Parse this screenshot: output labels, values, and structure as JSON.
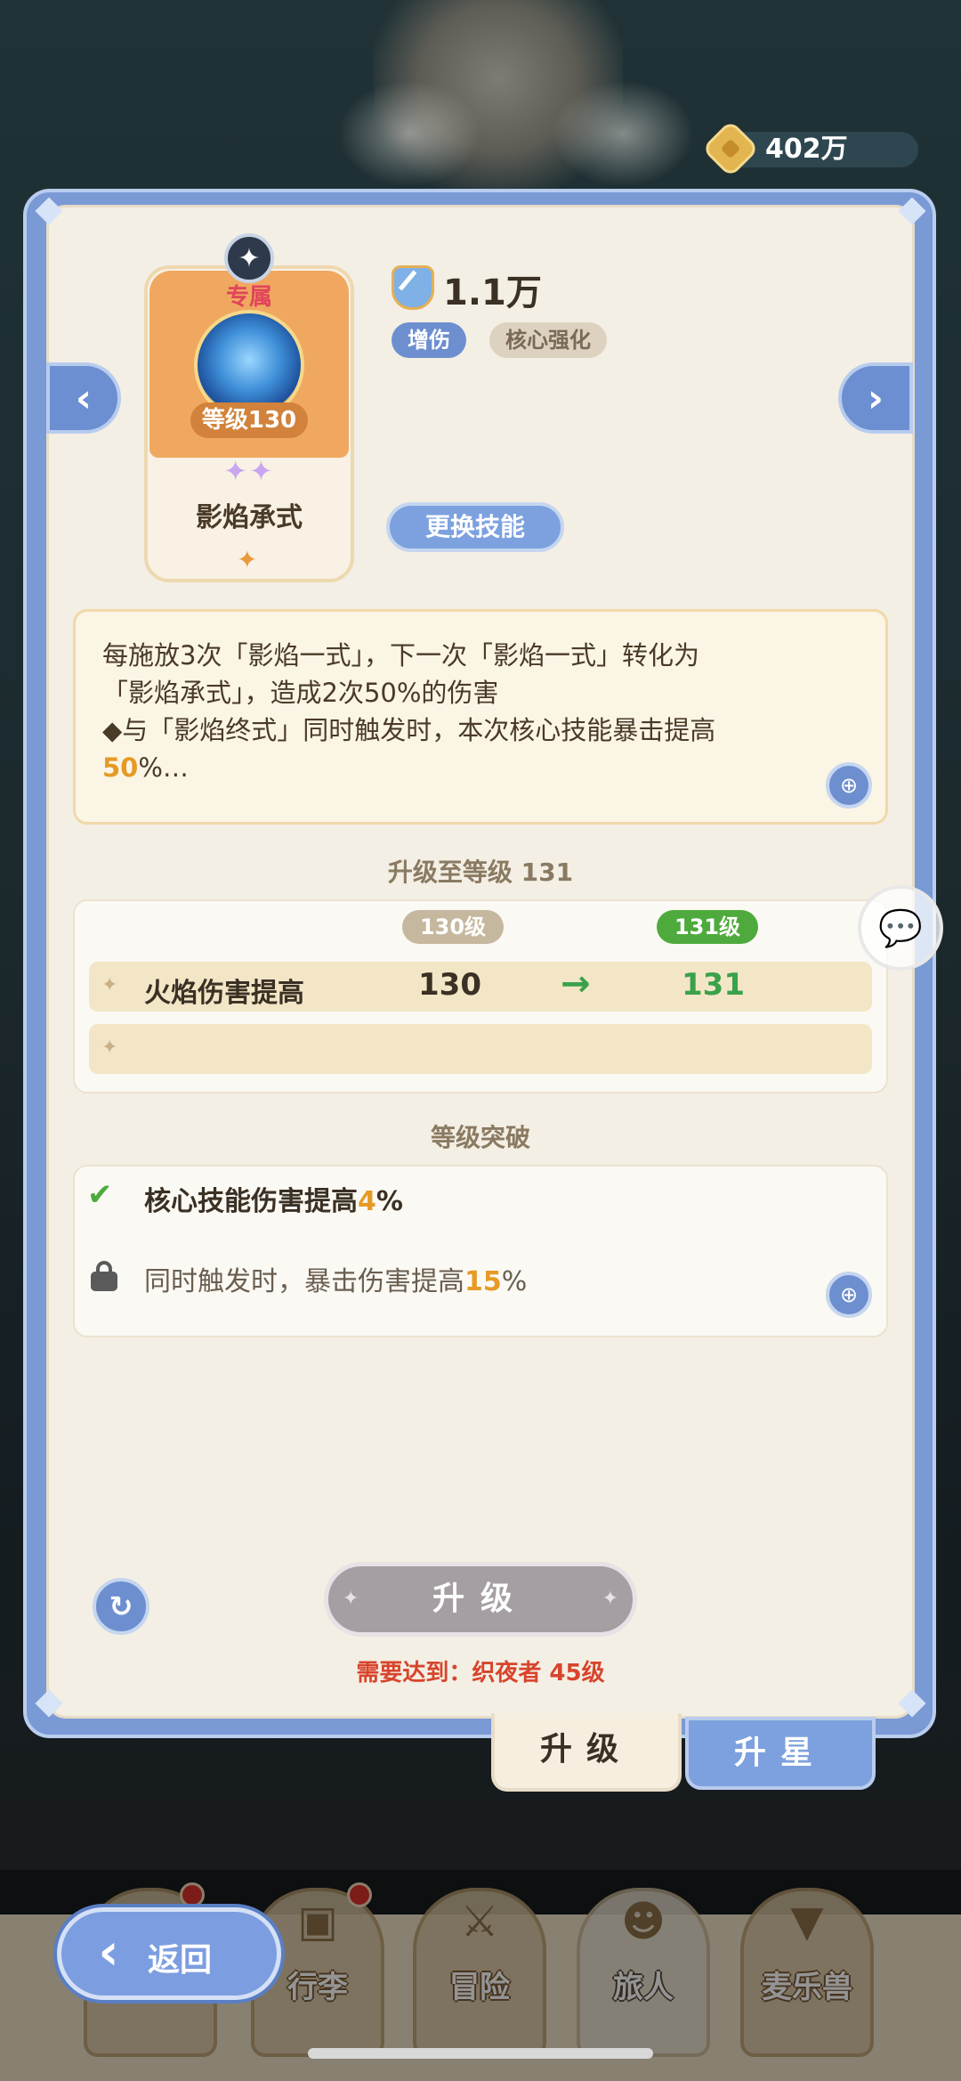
{
  "currency": {
    "amount": "402万",
    "icon": "gold-coin-icon"
  },
  "skill": {
    "exclusive_label": "专属",
    "level_label": "等级130",
    "name": "影焰承式",
    "stars": "✦✦",
    "power": "1.1万",
    "tags": [
      "增伤",
      "核心强化"
    ],
    "change_button": "更换技能"
  },
  "description": {
    "line1": "每施放3次「影焰一式」，下一次「影焰一式」转化为",
    "line2": "「影焰承式」，造成2次50%的伤害",
    "line3": "◆与「影焰终式」同时触发时，本次核心技能暴击提高",
    "line4_highlight": "50",
    "line4_rest": "%…"
  },
  "upgrade": {
    "title": "升级至等级 131",
    "from_level": "130级",
    "to_level": "131级",
    "rows": [
      {
        "stat": "火焰伤害提高",
        "from": "130",
        "arrow": "→",
        "to": "131"
      }
    ]
  },
  "breakthrough": {
    "title": "等级突破",
    "items": [
      {
        "text": "核心技能伤害提高",
        "value": "4",
        "unit": "%",
        "unlocked": true
      },
      {
        "text": "同时触发时，暴击伤害提高",
        "value": "15",
        "unit": "%",
        "unlocked": false
      }
    ]
  },
  "actions": {
    "upgrade_button": "升级",
    "requirement": "需要达到：织夜者  45级"
  },
  "tabs": {
    "upgrade": "升级",
    "star_up": "升星",
    "active": "upgrade"
  },
  "bottom_nav": {
    "back": "返回",
    "items": [
      {
        "label": "行李"
      },
      {
        "label": "冒险"
      },
      {
        "label": "旅人"
      },
      {
        "label": "麦乐兽"
      }
    ]
  },
  "colors": {
    "accent_blue": "#7ca1de",
    "highlight_orange": "#e69a24",
    "increase_green": "#3aa24a",
    "requirement_red": "#d8442c"
  }
}
